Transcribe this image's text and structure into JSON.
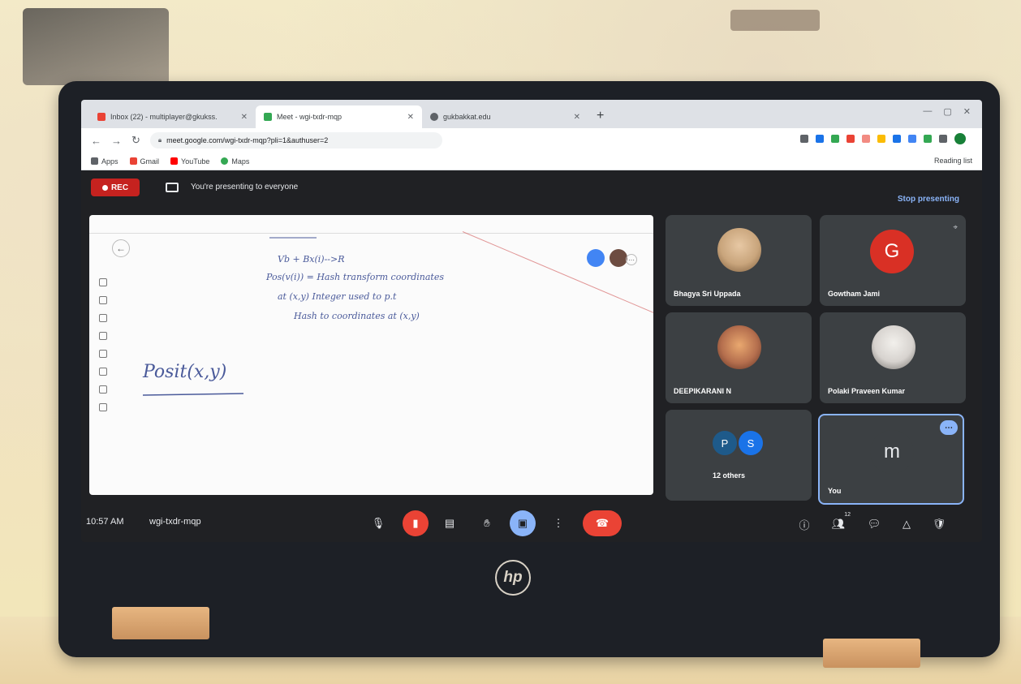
{
  "browser": {
    "tabs": [
      {
        "label": "Inbox (22) - multiplayer@gkukss.",
        "favicon_color": "#ea4335"
      },
      {
        "label": "Meet - wgi-txdr-mqp",
        "favicon_color": "#34a853"
      },
      {
        "label": "gukbakkat.edu",
        "favicon_color": "#5f6368"
      }
    ],
    "new_tab": "+",
    "url": "meet.google.com/wgi-txdr-mqp?pli=1&authuser=2",
    "bookmarks": [
      "Apps",
      "Gmail",
      "YouTube",
      "Maps"
    ],
    "reading_list": "Reading list"
  },
  "meet": {
    "rec_label": "REC",
    "presenting_text": "You're presenting to everyone",
    "stop_presenting": "Stop presenting",
    "time": "10:57 AM",
    "meeting_code": "wgi-txdr-mqp",
    "participants_count_badge": "12"
  },
  "whiteboard": {
    "lines": [
      "Vb + Bx(i)-->R",
      "Pos(v(i)) = Hash transform coordinates",
      "at (x,y) Integer used to p.t",
      "Hash to coordinates at (x,y)"
    ],
    "big_word": "Posit(x,y)"
  },
  "participants": [
    {
      "name": "Bhagya Sri Uppada",
      "kind": "photo",
      "color": "#c9a57c"
    },
    {
      "name": "Gowtham Jami",
      "kind": "letter",
      "letter": "G",
      "color": "#d93025"
    },
    {
      "name": "DEEPIKARANI N",
      "kind": "photo",
      "color": "#b56f4e"
    },
    {
      "name": "Polaki Praveen Kumar",
      "kind": "photo",
      "color": "#d7d3cf"
    },
    {
      "name": "12 others",
      "kind": "group",
      "letters": [
        "P",
        "S"
      ],
      "colors": [
        "#1e5a8a",
        "#1a73e8"
      ]
    },
    {
      "name": "You",
      "kind": "letter",
      "letter": "m",
      "color": "#3c4043"
    }
  ],
  "hp_logo": "hp"
}
